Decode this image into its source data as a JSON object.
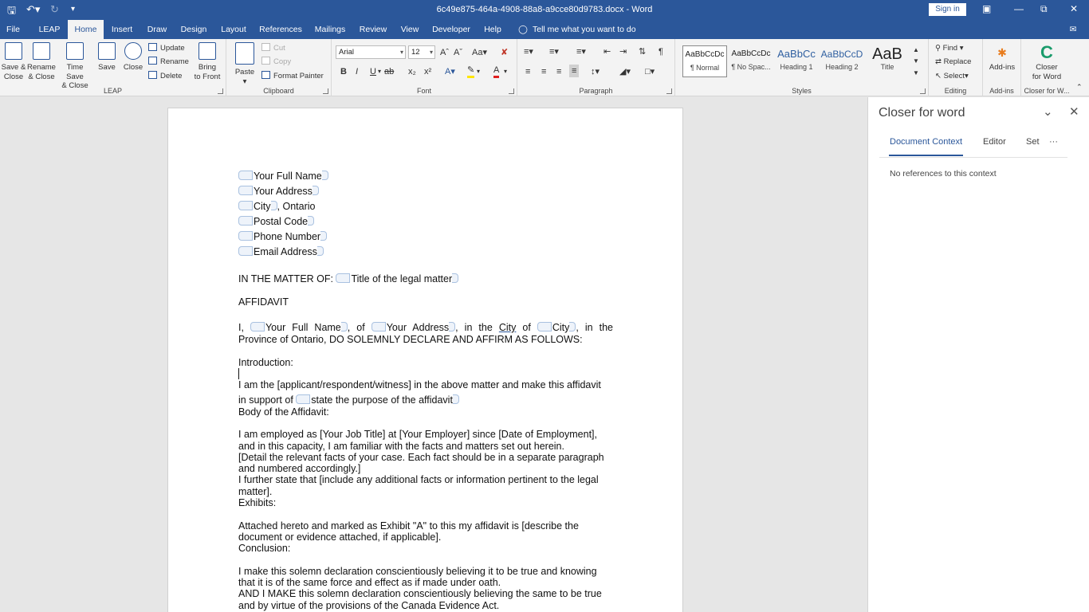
{
  "titlebar": {
    "title": "6c49e875-464a-4908-88a8-a9cce80d9783.docx - Word",
    "sign_in": "Sign in"
  },
  "tabs": [
    {
      "label": "File"
    },
    {
      "label": "LEAP"
    },
    {
      "label": "Home"
    },
    {
      "label": "Insert"
    },
    {
      "label": "Draw"
    },
    {
      "label": "Design"
    },
    {
      "label": "Layout"
    },
    {
      "label": "References"
    },
    {
      "label": "Mailings"
    },
    {
      "label": "Review"
    },
    {
      "label": "View"
    },
    {
      "label": "Developer"
    },
    {
      "label": "Help"
    }
  ],
  "active_tab": "Home",
  "tell_me": "Tell me what you want to do",
  "ribbon": {
    "leap": {
      "label": "LEAP",
      "buttons": [
        {
          "l1": "Save &",
          "l2": "Close"
        },
        {
          "l1": "Rename",
          "l2": "& Close"
        },
        {
          "l1": "Time Save",
          "l2": "& Close"
        },
        {
          "l1": "Save",
          "l2": ""
        },
        {
          "l1": "Close",
          "l2": ""
        }
      ],
      "small": [
        "Update",
        "Rename",
        "Delete"
      ],
      "bring": {
        "l1": "Bring",
        "l2": "to Front"
      }
    },
    "clipboard": {
      "label": "Clipboard",
      "paste": "Paste",
      "cut": "Cut",
      "copy": "Copy",
      "format_painter": "Format Painter"
    },
    "font": {
      "label": "Font",
      "family": "Arial",
      "size": "12",
      "case": "Aa"
    },
    "paragraph": {
      "label": "Paragraph"
    },
    "styles": {
      "label": "Styles",
      "items": [
        {
          "preview": "AaBbCcDc",
          "name": "¶ Normal"
        },
        {
          "preview": "AaBbCcDc",
          "name": "¶ No Spac..."
        },
        {
          "preview": "AaBbCc",
          "name": "Heading 1"
        },
        {
          "preview": "AaBbCcD",
          "name": "Heading 2"
        },
        {
          "preview": "AaB",
          "name": "Title"
        }
      ]
    },
    "editing": {
      "label": "Editing",
      "find": "Find",
      "replace": "Replace",
      "select": "Select"
    },
    "addins": {
      "label": "Add-ins",
      "button": "Add-ins"
    },
    "closer": {
      "label": "Closer for W...",
      "l1": "Closer",
      "l2": "for Word"
    }
  },
  "document": {
    "header_fields": [
      "Your Full Name",
      "Your Address",
      "City",
      "Postal Code",
      "Phone Number",
      "Email Address"
    ],
    "city_suffix": ", Ontario",
    "matter_prefix": "IN THE MATTER OF: ",
    "matter_field": "Title of the legal matter",
    "affidavit_heading": "AFFIDAVIT",
    "decl": {
      "i": "I,",
      "name": "Your Full Name",
      "of1": ", of",
      "address": "Your Address",
      "in_the": ", in the",
      "city_word": "City",
      "of2": "of",
      "city": "City",
      "in_the2": ", in the",
      "line2": "Province of Ontario, DO SOLEMNLY DECLARE AND AFFIRM AS FOLLOWS:"
    },
    "introduction": "Introduction:",
    "intro_l1": "I am the [applicant/respondent/witness] in the above matter and make this affidavit",
    "intro_l2_prefix": "in support of ",
    "intro_field": "state the purpose of the affidavit",
    "body_heading": "Body of the Affidavit:",
    "body": [
      "I am employed as [Your Job Title] at [Your Employer] since [Date of Employment],",
      "and in this capacity, I am familiar with the facts and matters set out herein.",
      "[Detail the relevant facts of your case. Each fact should be in a separate paragraph",
      "and numbered accordingly.]",
      "I further state that [include any additional facts or information pertinent to the legal",
      "matter].",
      "Exhibits:"
    ],
    "exhibits": [
      "Attached hereto and marked as Exhibit \"A\" to this my affidavit is [describe the",
      "document or evidence attached, if applicable].",
      "Conclusion:"
    ],
    "conclusion": [
      "I make this solemn declaration conscientiously believing it to be true and knowing",
      "that it is of the same force and effect as if made under oath.",
      "AND I MAKE this solemn declaration conscientiously believing the same to be true",
      "and by virtue of the provisions of the Canada Evidence Act."
    ]
  },
  "pane": {
    "title": "Closer for word",
    "tabs": [
      "Document Context",
      "Editor",
      "Set"
    ],
    "more": "···",
    "message": "No references to this context"
  },
  "colors": {
    "accent": "#2b579a",
    "ribbon_bg": "#f3f3f3",
    "workspace": "#e6e6e6"
  }
}
